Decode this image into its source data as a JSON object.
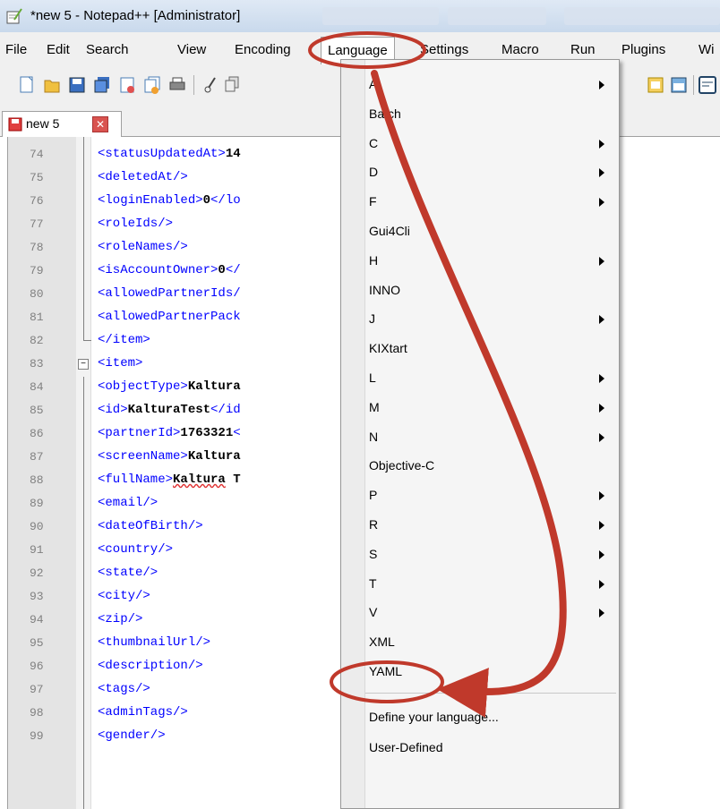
{
  "window": {
    "title": "*new  5 - Notepad++ [Administrator]"
  },
  "menubar": {
    "items": [
      "File",
      "Edit",
      "Search",
      "View",
      "Encoding",
      "Language",
      "Settings",
      "Macro",
      "Run",
      "Plugins",
      "Wi"
    ]
  },
  "tab": {
    "label": "new  5",
    "close_glyph": "✕"
  },
  "editor": {
    "lines": [
      {
        "n": "74",
        "tag": "<statusUpdatedAt>",
        "text": "14"
      },
      {
        "n": "75",
        "tag": "<deletedAt/>",
        "text": ""
      },
      {
        "n": "76",
        "tag": "<loginEnabled>",
        "text": "0",
        "tail": "</lo"
      },
      {
        "n": "77",
        "tag": "<roleIds/>",
        "text": ""
      },
      {
        "n": "78",
        "tag": "<roleNames/>",
        "text": ""
      },
      {
        "n": "79",
        "tag": "<isAccountOwner>",
        "text": "0",
        "tail": "</"
      },
      {
        "n": "80",
        "tag": "<allowedPartnerIds/",
        "text": ""
      },
      {
        "n": "81",
        "tag": "<allowedPartnerPack",
        "text": ""
      },
      {
        "n": "82",
        "tag": "</item>",
        "text": ""
      },
      {
        "n": "83",
        "tag": "<item>",
        "text": ""
      },
      {
        "n": "84",
        "tag": "<objectType>",
        "text": "Kaltura"
      },
      {
        "n": "85",
        "tag": "<id>",
        "text": "KalturaTest",
        "tail": "</id"
      },
      {
        "n": "86",
        "tag": "<partnerId>",
        "text": "1763321",
        "tail": "<"
      },
      {
        "n": "87",
        "tag": "<screenName>",
        "text": "Kaltura"
      },
      {
        "n": "88",
        "tag": "<fullName>",
        "text": "Kaltura",
        "tail": " T"
      },
      {
        "n": "89",
        "tag": "<email/>",
        "text": ""
      },
      {
        "n": "90",
        "tag": "<dateOfBirth/>",
        "text": ""
      },
      {
        "n": "91",
        "tag": "<country/>",
        "text": ""
      },
      {
        "n": "92",
        "tag": "<state/>",
        "text": ""
      },
      {
        "n": "93",
        "tag": "<city/>",
        "text": ""
      },
      {
        "n": "94",
        "tag": "<zip/>",
        "text": ""
      },
      {
        "n": "95",
        "tag": "<thumbnailUrl/>",
        "text": ""
      },
      {
        "n": "96",
        "tag": "<description/>",
        "text": ""
      },
      {
        "n": "97",
        "tag": "<tags/>",
        "text": ""
      },
      {
        "n": "98",
        "tag": "<adminTags/>",
        "text": ""
      },
      {
        "n": "99",
        "tag": "<gender/>",
        "text": ""
      }
    ]
  },
  "language_menu": {
    "items": [
      {
        "label": "A",
        "submenu": true
      },
      {
        "label": "Batch",
        "submenu": false
      },
      {
        "label": "C",
        "submenu": true
      },
      {
        "label": "D",
        "submenu": true
      },
      {
        "label": "F",
        "submenu": true
      },
      {
        "label": "Gui4Cli",
        "submenu": false
      },
      {
        "label": "H",
        "submenu": true
      },
      {
        "label": "INNO",
        "submenu": false
      },
      {
        "label": "J",
        "submenu": true
      },
      {
        "label": "KIXtart",
        "submenu": false
      },
      {
        "label": "L",
        "submenu": true
      },
      {
        "label": "M",
        "submenu": true
      },
      {
        "label": "N",
        "submenu": true
      },
      {
        "label": "Objective-C",
        "submenu": false
      },
      {
        "label": "P",
        "submenu": true
      },
      {
        "label": "R",
        "submenu": true
      },
      {
        "label": "S",
        "submenu": true
      },
      {
        "label": "T",
        "submenu": true
      },
      {
        "label": "V",
        "submenu": true
      },
      {
        "label": "XML",
        "submenu": false
      },
      {
        "label": "YAML",
        "submenu": false
      }
    ],
    "footer_items": [
      {
        "label": "Define your language..."
      },
      {
        "label": "User-Defined"
      }
    ]
  },
  "colors": {
    "annotation": "#c0392b",
    "tag": "#0000ff",
    "line_number": "#808080"
  }
}
